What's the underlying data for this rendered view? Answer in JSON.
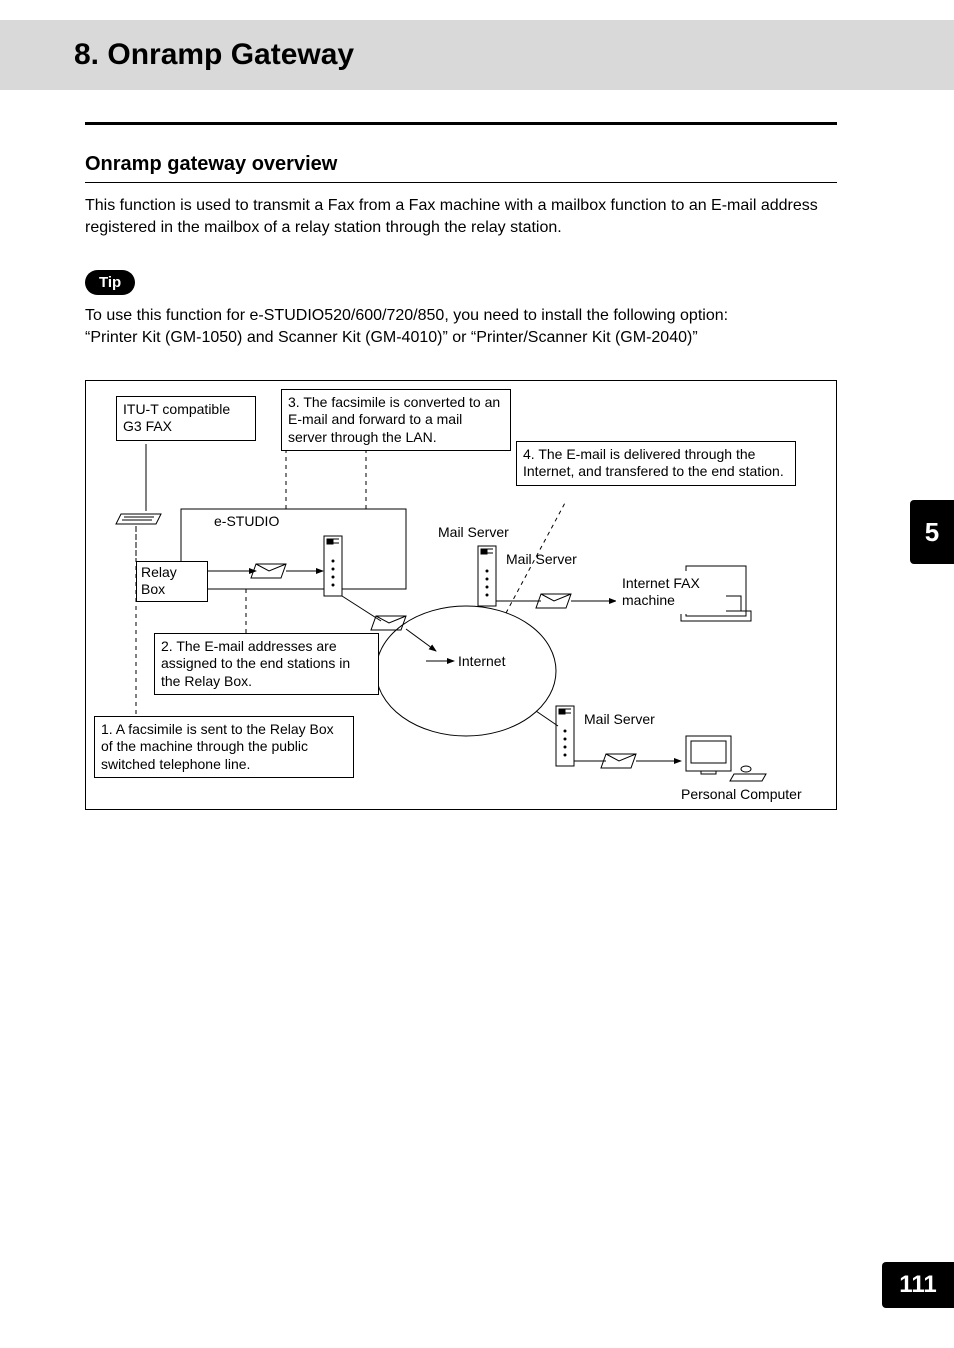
{
  "header": {
    "title": "8. Onramp Gateway"
  },
  "section": {
    "heading": "Onramp gateway overview",
    "intro": "This function is used to transmit a Fax from a Fax machine with a mailbox function to an E-mail address registered in the mailbox of a relay station through the relay station."
  },
  "tip": {
    "label": "Tip",
    "line1": "To use this function for e-STUDIO520/600/720/850, you need to install the following option:",
    "line2": "“Printer Kit (GM-1050) and Scanner Kit (GM-4010)” or “Printer/Scanner Kit (GM-2040)”"
  },
  "diagram": {
    "step1": "1.  A facsimile is sent to the Relay Box of the machine through the public switched telephone line.",
    "step2": "2.  The E-mail addresses are assigned to the end stations in the Relay Box.",
    "step3": "3.  The facsimile is converted to an E-mail and forward to a mail server through the LAN.",
    "step4": "4.  The E-mail is delivered through the Internet, and transfered to the end station.",
    "itut": "ITU-T compatible G3 FAX",
    "estudio": "e-STUDIO",
    "relaybox": "Relay Box",
    "mailserver": "Mail Server",
    "internet": "Internet",
    "ifax": "Internet FAX machine",
    "pc": "Personal Computer"
  },
  "nav": {
    "chapter": "5",
    "page": "111"
  }
}
